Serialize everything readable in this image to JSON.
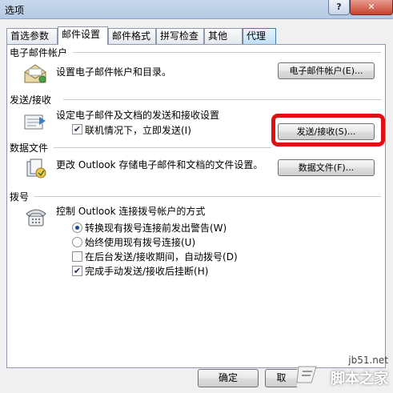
{
  "window": {
    "title": "选项",
    "help_label": "?",
    "close_label": "✕"
  },
  "tabs": [
    {
      "label": "首选参数",
      "active": false
    },
    {
      "label": "邮件设置",
      "active": true
    },
    {
      "label": "邮件格式",
      "active": false
    },
    {
      "label": "拼写检查",
      "active": false
    },
    {
      "label": "其他",
      "active": false
    },
    {
      "label": "代理",
      "active": false
    }
  ],
  "email_accounts": {
    "title": "电子邮件帐户",
    "description": "设置电子邮件帐户和目录。",
    "button": "电子邮件帐户(E)...",
    "icon": "envelope-icon"
  },
  "send_receive": {
    "title": "发送/接收",
    "description": "设定电子邮件及文档的发送和接收设置",
    "checkbox_label": "联机情况下，立即发送(I)",
    "checkbox_checked": true,
    "button": "发送/接收(S)...",
    "icon": "send-receive-icon",
    "highlight_color": "#e01010"
  },
  "data_files": {
    "title": "数据文件",
    "description": "更改 Outlook 存储电子邮件和文档的文件设置。",
    "button": "数据文件(F)...",
    "icon": "data-file-icon"
  },
  "dial_up": {
    "title": "拨号",
    "description": "控制 Outlook 连接拨号帐户的方式",
    "icon": "telephone-icon",
    "options": [
      {
        "type": "radio",
        "label": "转换现有拨号连接前发出警告(W)",
        "checked": true
      },
      {
        "type": "radio",
        "label": "始终使用现有拨号连接(U)",
        "checked": false
      },
      {
        "type": "checkbox",
        "label": "在后台发送/接收期间，自动拨号(D)",
        "checked": false
      },
      {
        "type": "checkbox",
        "label": "完成手动发送/接收后挂断(H)",
        "checked": true
      }
    ]
  },
  "footer": {
    "ok_label": "确定",
    "cancel_label": "取"
  },
  "watermark": {
    "site": "jb51.net",
    "name": "脚本之家"
  }
}
